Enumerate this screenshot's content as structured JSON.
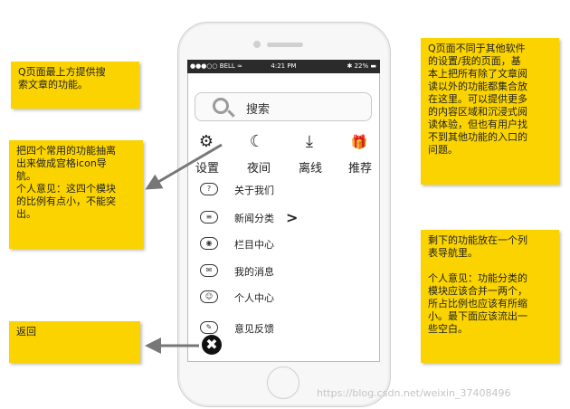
{
  "notes": {
    "search_note": "Q页面最上方提供搜\n索文章的功能。",
    "grid_note": "把四个常用的功能抽离\n出来做成宫格icon导\n航。\n个人意见：这四个模块\n的比例有点小，不能突\n出。",
    "back_note": "返回",
    "overview_note": "Q页面不同于其他软件\n的设置/我的页面，基\n本上把所有除了文章阅\n读以外的功能都集合放\n在这里。可以提供更多\n的内容区域和沉浸式阅\n读体验，但也有用户找\n不到其他功能的入口的\n问题。",
    "list_note": "剩下的功能放在一个列\n表导航里。\n\n个人意见：功能分类的\n模块应该合并一两个，\n所占比例也应该有所缩\n小。最下面应该流出一\n些空白。"
  },
  "status_bar": {
    "carrier": "●●●○○ BELL ≈",
    "time": "4:21 PM",
    "battery": "✱ 22% ▬"
  },
  "search": {
    "label": "搜索"
  },
  "grid": [
    {
      "label": "设置",
      "icon": "gear-icon",
      "glyph": "⚙"
    },
    {
      "label": "夜间",
      "icon": "moon-icon",
      "glyph": "☾"
    },
    {
      "label": "离线",
      "icon": "download-icon",
      "glyph": "⤓"
    },
    {
      "label": "推荐",
      "icon": "gift-icon",
      "glyph": "🎁"
    }
  ],
  "menu": [
    {
      "label": "关于我们",
      "icon": "question-icon",
      "glyph": "?"
    },
    {
      "label": "新闻分类",
      "icon": "list-icon",
      "glyph": "≡"
    },
    {
      "label": "栏目中心",
      "icon": "eye-icon",
      "glyph": "◉"
    },
    {
      "label": "我的消息",
      "icon": "mail-icon",
      "glyph": "✉"
    },
    {
      "label": "个人中心",
      "icon": "user-icon",
      "glyph": "☺"
    },
    {
      "label": "意见反馈",
      "icon": "edit-icon",
      "glyph": "✎"
    }
  ],
  "chevron": ">",
  "close_glyph": "✖",
  "watermark": "https://blog.csdn.net/weixin_37408496"
}
